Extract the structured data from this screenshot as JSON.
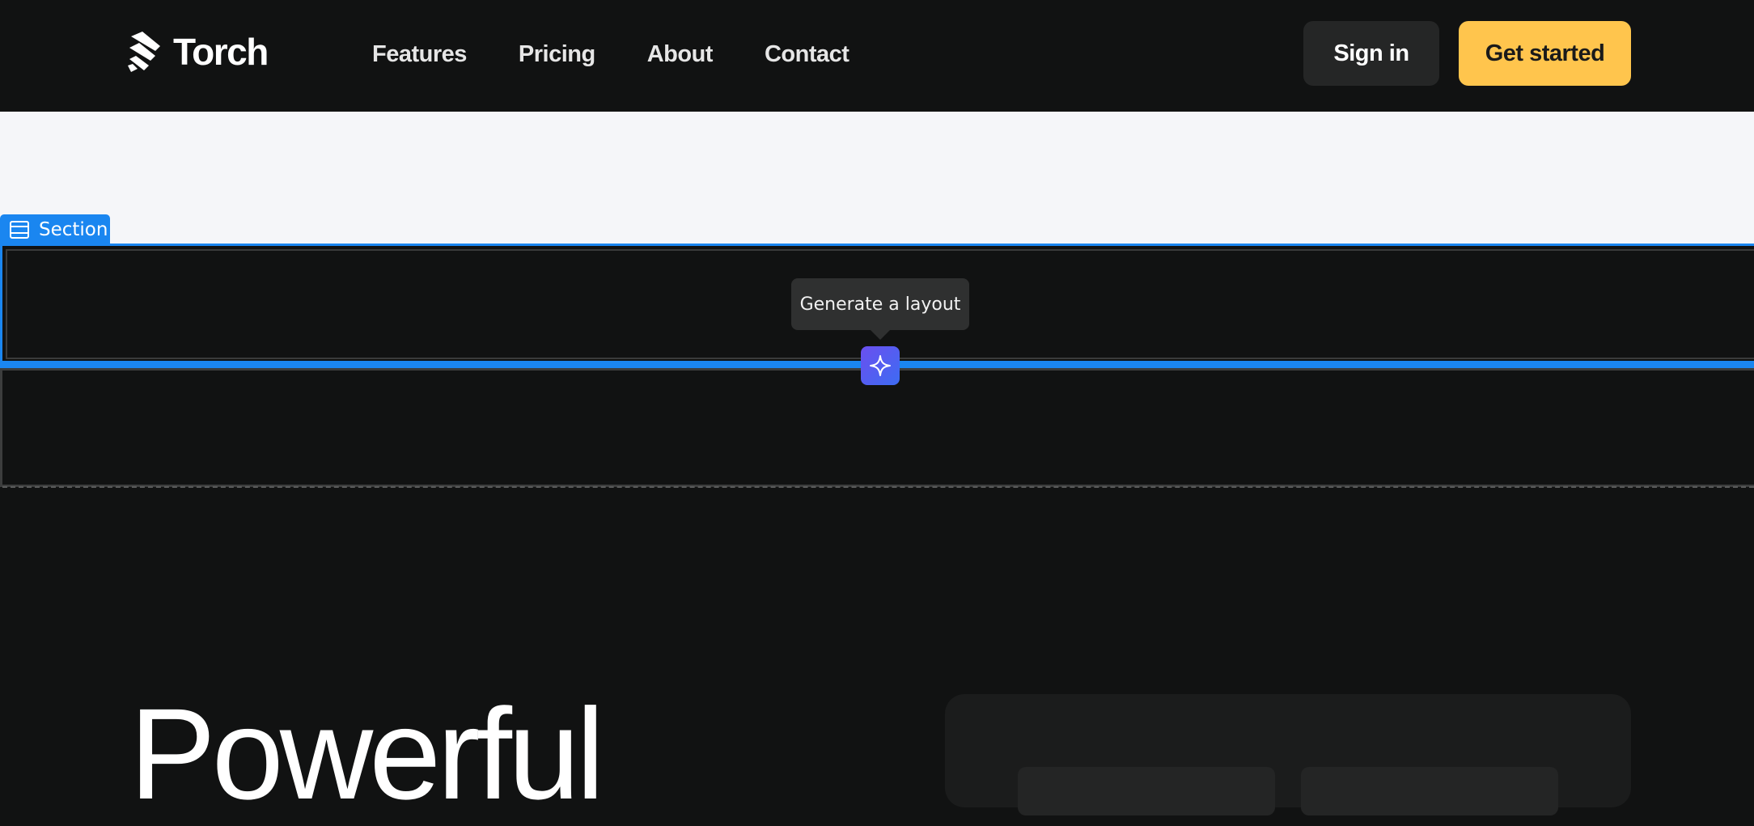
{
  "navbar": {
    "brand": "Torch",
    "links": [
      "Features",
      "Pricing",
      "About",
      "Contact"
    ],
    "sign_in_label": "Sign in",
    "get_started_label": "Get started"
  },
  "editor": {
    "section_tag_label": "Section",
    "tooltip_text": "Generate a layout"
  },
  "hero": {
    "title": "Powerful"
  },
  "colors": {
    "background": "#111212",
    "accent_blue": "#1a86f0",
    "cta_yellow": "#ffc54d",
    "light_band": "#f5f6f9",
    "generate_gradient_start": "#6b4ff0",
    "generate_gradient_end": "#3d6cf2"
  },
  "icons": {
    "logo": "torch-logo-icon",
    "section_tag": "section-layout-icon",
    "generate": "sparkle-icon"
  }
}
